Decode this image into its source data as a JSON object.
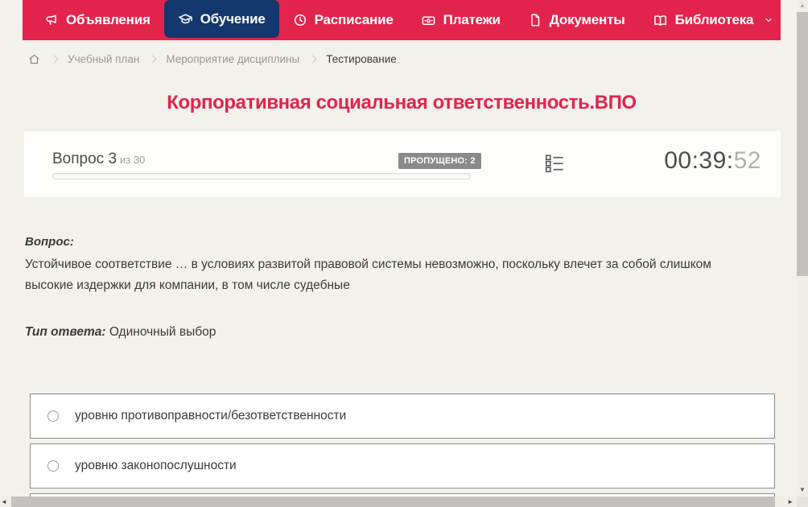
{
  "nav": {
    "items": [
      {
        "label": "Объявления",
        "icon": "megaphone-icon",
        "active": false
      },
      {
        "label": "Обучение",
        "icon": "graduation-cap-icon",
        "active": true
      },
      {
        "label": "Расписание",
        "icon": "clock-icon",
        "active": false
      },
      {
        "label": "Платежи",
        "icon": "payment-card-icon",
        "active": false
      },
      {
        "label": "Документы",
        "icon": "document-icon",
        "active": false
      },
      {
        "label": "Библиотека",
        "icon": "book-icon",
        "active": false,
        "dropdown": true
      }
    ]
  },
  "breadcrumb": {
    "home_icon": "home-icon",
    "items": [
      "Учебный план",
      "Мероприятие дисциплины",
      "Тестирование"
    ]
  },
  "page_title": "Корпоративная социальная ответственность.ВПО",
  "question_panel": {
    "question_label": "Вопрос 3",
    "question_total": "из 30",
    "skipped_badge": "ПРОПУЩЕНО: 2",
    "progress_percent": 0,
    "questions_list_icon": "question-list-icon",
    "timer": {
      "main": "00:39:",
      "seconds": "52"
    }
  },
  "question": {
    "label": "Вопрос:",
    "text": "Устойчивое соответствие … в условиях развитой правовой системы невозможно, поскольку влечет за собой слишком высокие издержки для компании, в том числе судебные",
    "answer_type_label": "Тип ответа:",
    "answer_type_value": "Одиночный выбор"
  },
  "options": [
    {
      "label": "уровню противоправности/безответственности",
      "selected": false
    },
    {
      "label": "уровню законопослушности",
      "selected": false
    },
    {
      "label": "",
      "selected": false,
      "partially_visible": true
    }
  ],
  "colors": {
    "accent_red": "#e2234c",
    "active_tab_navy": "#14386d",
    "page_bg": "#f2f1ec",
    "badge_gray": "#8a8a8a",
    "timer_dim": "#b3b1ad",
    "option_border": "#8b8b8b",
    "scrollbar_thumb": "#c2c1be"
  }
}
